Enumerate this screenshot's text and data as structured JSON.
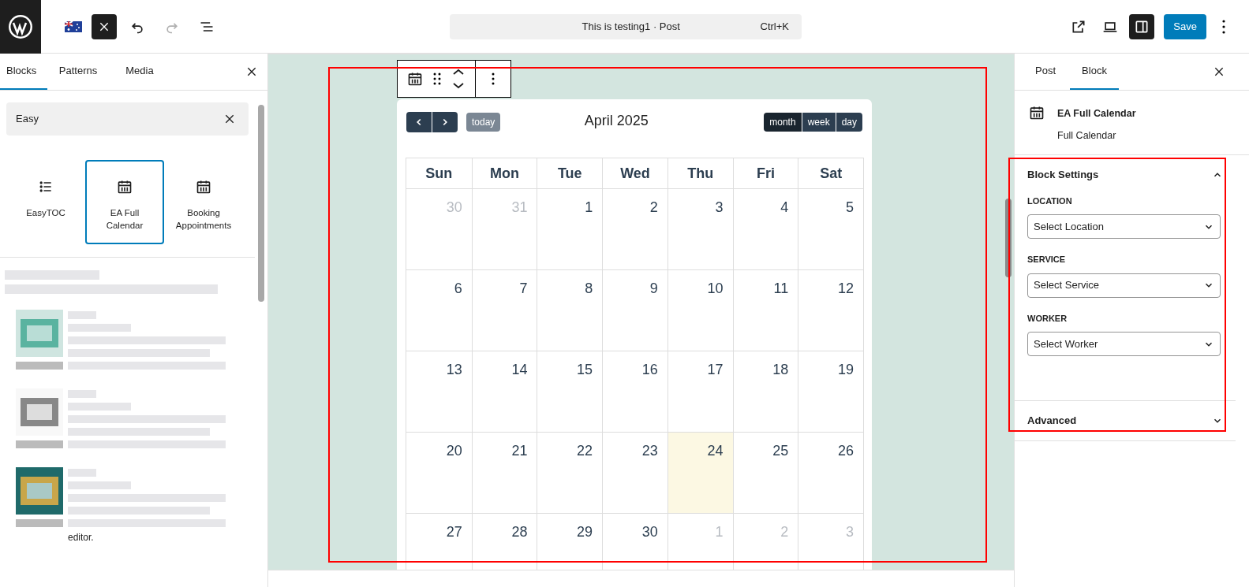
{
  "top_bar": {
    "title": "This is testing1 · Post",
    "shortcut": "Ctrl+K",
    "save": "Save",
    "redo_disabled": true
  },
  "inserter": {
    "tabs": [
      {
        "label": "Blocks",
        "selected": true
      },
      {
        "label": "Patterns",
        "selected": false
      },
      {
        "label": "Media",
        "selected": false
      }
    ],
    "search": {
      "value": "Easy"
    },
    "blocks": [
      {
        "label": "EasyTOC",
        "kind": "list",
        "selected": false
      },
      {
        "label": "EA Full Calendar",
        "kind": "calendar",
        "selected": true
      },
      {
        "label": "Booking Appointments",
        "kind": "calendar",
        "selected": false
      }
    ],
    "pattern_tail": "editor."
  },
  "canvas": {
    "calendar": {
      "title": "April 2025",
      "today_button": "today",
      "views": [
        {
          "label": "month",
          "selected": true
        },
        {
          "label": "week",
          "selected": false
        },
        {
          "label": "day",
          "selected": false
        }
      ],
      "weekdays": [
        "Sun",
        "Mon",
        "Tue",
        "Wed",
        "Thu",
        "Fri",
        "Sat"
      ],
      "weeks": [
        [
          {
            "day": "30",
            "other_month": true,
            "today": false
          },
          {
            "day": "31",
            "other_month": true,
            "today": false
          },
          {
            "day": "1",
            "other_month": false,
            "today": false
          },
          {
            "day": "2",
            "other_month": false,
            "today": false
          },
          {
            "day": "3",
            "other_month": false,
            "today": false
          },
          {
            "day": "4",
            "other_month": false,
            "today": false
          },
          {
            "day": "5",
            "other_month": false,
            "today": false
          }
        ],
        [
          {
            "day": "6",
            "other_month": false,
            "today": false
          },
          {
            "day": "7",
            "other_month": false,
            "today": false
          },
          {
            "day": "8",
            "other_month": false,
            "today": false
          },
          {
            "day": "9",
            "other_month": false,
            "today": false
          },
          {
            "day": "10",
            "other_month": false,
            "today": false
          },
          {
            "day": "11",
            "other_month": false,
            "today": false
          },
          {
            "day": "12",
            "other_month": false,
            "today": false
          }
        ],
        [
          {
            "day": "13",
            "other_month": false,
            "today": false
          },
          {
            "day": "14",
            "other_month": false,
            "today": false
          },
          {
            "day": "15",
            "other_month": false,
            "today": false
          },
          {
            "day": "16",
            "other_month": false,
            "today": false
          },
          {
            "day": "17",
            "other_month": false,
            "today": false
          },
          {
            "day": "18",
            "other_month": false,
            "today": false
          },
          {
            "day": "19",
            "other_month": false,
            "today": false
          }
        ],
        [
          {
            "day": "20",
            "other_month": false,
            "today": false
          },
          {
            "day": "21",
            "other_month": false,
            "today": false
          },
          {
            "day": "22",
            "other_month": false,
            "today": false
          },
          {
            "day": "23",
            "other_month": false,
            "today": false
          },
          {
            "day": "24",
            "other_month": false,
            "today": true
          },
          {
            "day": "25",
            "other_month": false,
            "today": false
          },
          {
            "day": "26",
            "other_month": false,
            "today": false
          }
        ],
        [
          {
            "day": "27",
            "other_month": false,
            "today": false
          },
          {
            "day": "28",
            "other_month": false,
            "today": false
          },
          {
            "day": "29",
            "other_month": false,
            "today": false
          },
          {
            "day": "30",
            "other_month": false,
            "today": false
          },
          {
            "day": "1",
            "other_month": true,
            "today": false
          },
          {
            "day": "2",
            "other_month": true,
            "today": false
          },
          {
            "day": "3",
            "other_month": true,
            "today": false
          }
        ]
      ]
    }
  },
  "settings": {
    "tabs": [
      {
        "label": "Post",
        "selected": false
      },
      {
        "label": "Block",
        "selected": true
      }
    ],
    "block": {
      "name": "EA Full Calendar",
      "description": "Full Calendar"
    },
    "panels": [
      {
        "title": "Block Settings",
        "expanded": true,
        "fields": [
          {
            "label": "LOCATION",
            "value": "Select Location"
          },
          {
            "label": "SERVICE",
            "value": "Select Service"
          },
          {
            "label": "WORKER",
            "value": "Select Worker"
          }
        ]
      },
      {
        "title": "Advanced",
        "expanded": false
      }
    ]
  }
}
